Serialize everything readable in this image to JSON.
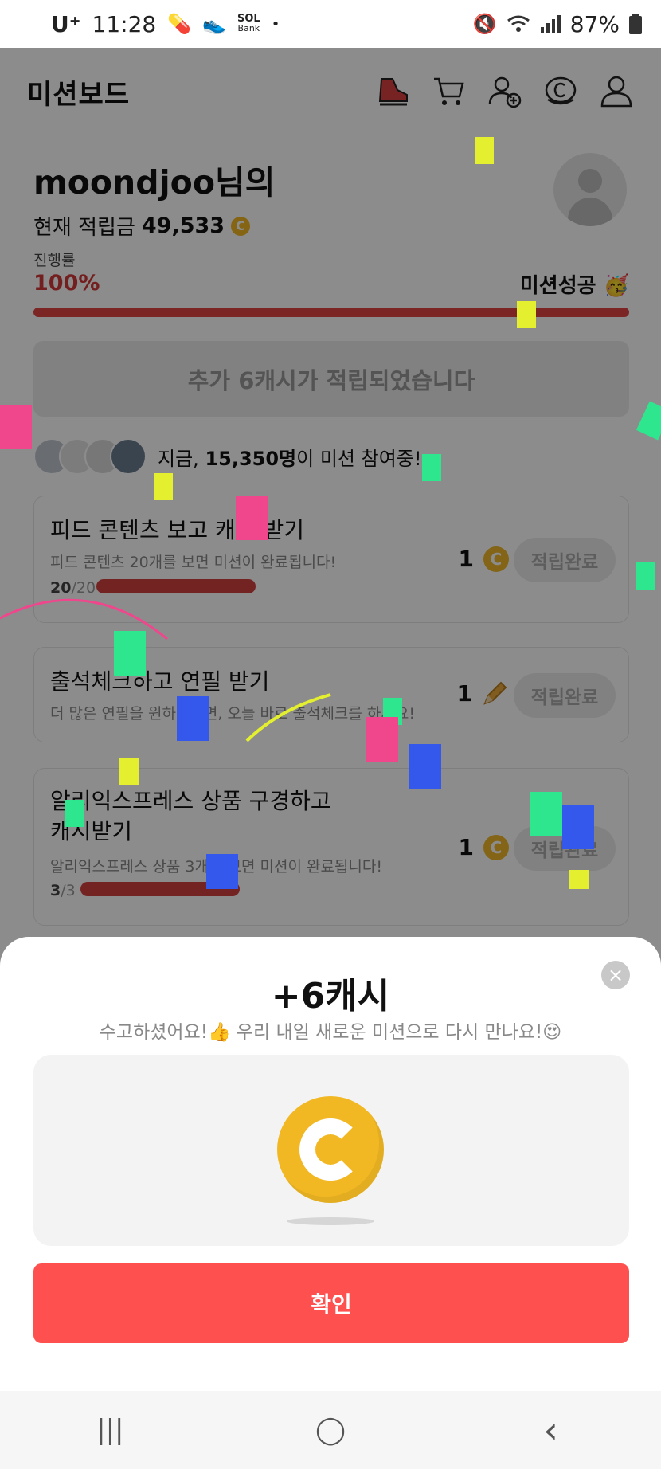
{
  "status_bar": {
    "carrier": "U⁺",
    "time": "11:28",
    "bank_label": "Bank",
    "bank_brand": "SOL",
    "battery": "87%"
  },
  "header": {
    "title": "미션보드",
    "icons": [
      "shoe-icon",
      "cart-icon",
      "add-user-icon",
      "coin-icon",
      "profile-icon"
    ]
  },
  "user": {
    "name": "moondjoo님의",
    "balance_label": "현재 적립금",
    "balance_value": "49,533"
  },
  "progress": {
    "label": "진행률",
    "value": "100%",
    "percent": 100,
    "status": "미션성공 🥳"
  },
  "bonus_message": "추가 6캐시가 적립되었습니다",
  "participants": {
    "prefix": "지금,",
    "count": "15,350명",
    "suffix": "이 미션 참여중!"
  },
  "missions": [
    {
      "title": "피드 콘텐츠 보고 캐시 받기",
      "desc": "피드 콘텐츠 20개를 보면 미션이 완료됩니다!",
      "done": "20",
      "total": "/20",
      "reward": "1",
      "reward_icon": "coin-icon",
      "button": "적립완료"
    },
    {
      "title": "출석체크하고 연필 받기",
      "desc": "더 많은 연필을 원하신다면, 오늘 바로 출석체크를 하세요!",
      "reward": "1",
      "reward_icon": "pencil-icon",
      "button": "적립완료"
    },
    {
      "title_line1": "알리익스프레스 상품 구경하고",
      "title_line2": "캐시받기",
      "desc": "알리익스프레스 상품 3개를 보면 미션이 완료됩니다!",
      "done": "3",
      "total": "/3",
      "reward": "1",
      "reward_icon": "coin-icon",
      "button": "적립완료"
    }
  ],
  "sheet": {
    "amount": "+6캐시",
    "message": "수고하셨어요!👍 우리 내일 새로운 미션으로 다시 만나요!😍",
    "confirm": "확인",
    "close": "×"
  },
  "navbar": {
    "recent": "|||",
    "home": "◯",
    "back": "‹"
  },
  "colors": {
    "accent": "#ff5050",
    "progress": "#e04444",
    "coin": "#f2b824"
  }
}
